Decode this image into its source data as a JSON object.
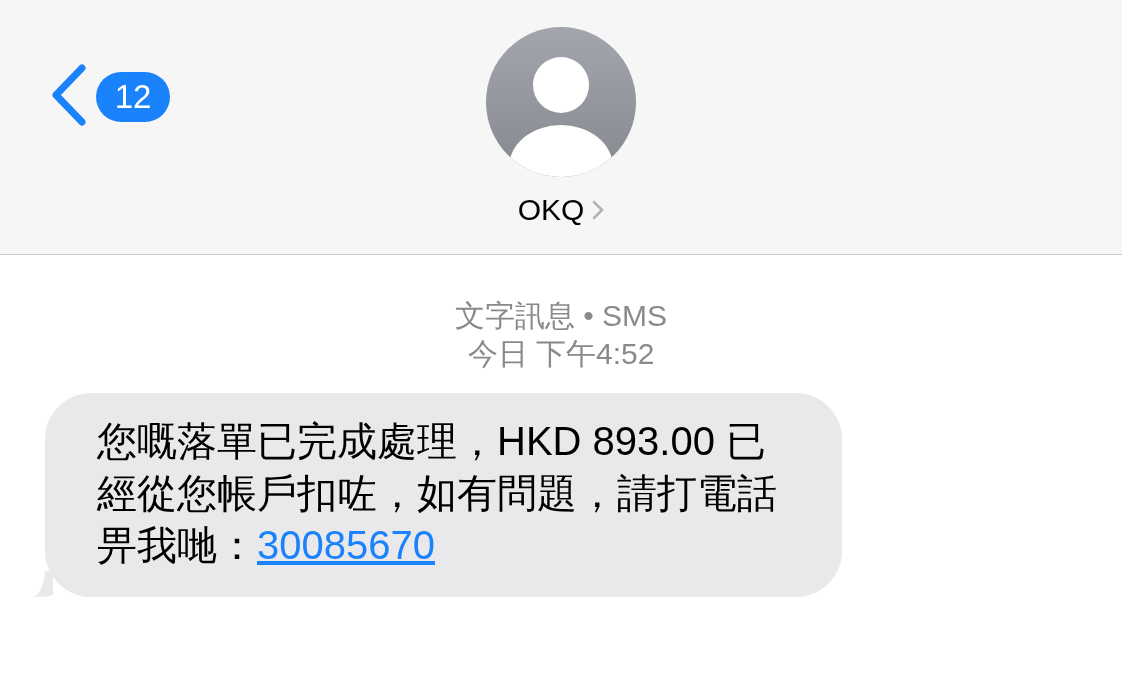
{
  "header": {
    "back_badge": "12",
    "contact_name": "OKQ"
  },
  "conversation": {
    "service": "文字訊息 • SMS",
    "timestamp": "今日 下午4:52",
    "messages": [
      {
        "kind": "incoming",
        "text": "您嘅落單已完成處理，HKD 893.00 已經從您帳戶扣咗，如有問題，請打電話畀我哋：",
        "link": "30085670"
      }
    ]
  }
}
